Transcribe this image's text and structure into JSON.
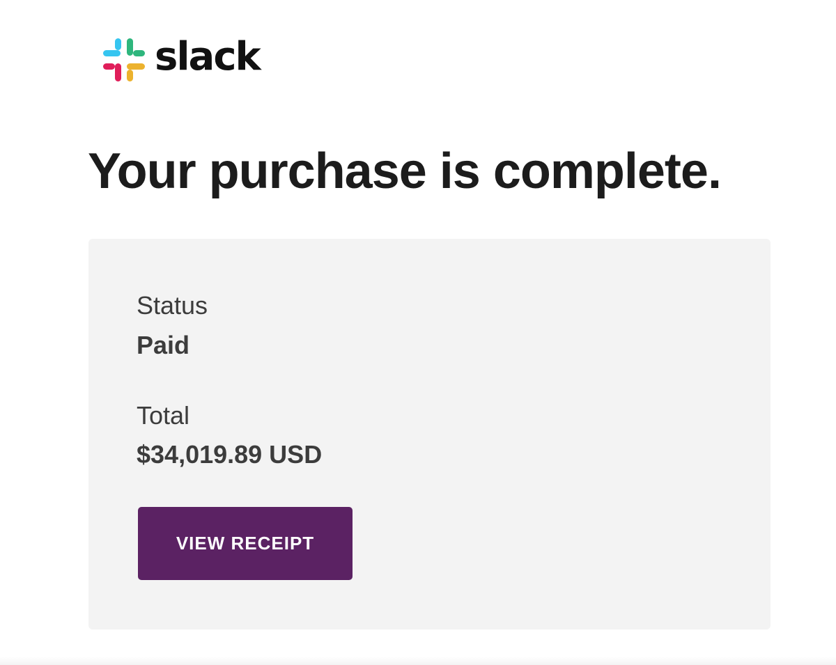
{
  "brand": {
    "name": "slack",
    "logo_icon": "slack-hash-logo-icon",
    "colors": {
      "blue": "#36c5f0",
      "green": "#2eb67d",
      "red": "#e01e5a",
      "yellow": "#ecb22e"
    }
  },
  "page": {
    "headline": "Your purchase is complete."
  },
  "summary": {
    "status_label": "Status",
    "status_value": "Paid",
    "total_label": "Total",
    "total_value": "$34,019.89 USD"
  },
  "actions": {
    "view_receipt_label": "VIEW RECEIPT",
    "button_color": "#5b2263"
  }
}
